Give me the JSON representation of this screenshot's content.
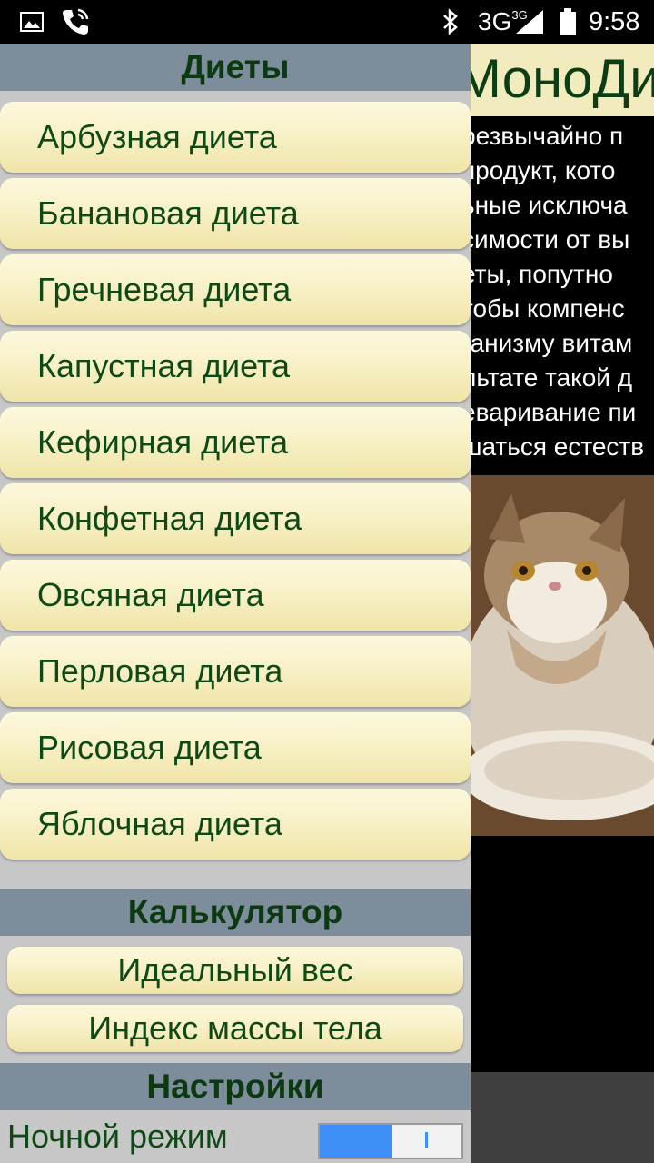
{
  "status_bar": {
    "network": "3G",
    "network_sup": "3G",
    "time": "9:58",
    "icons": [
      "gallery-icon",
      "wifi-call-icon",
      "bluetooth-icon",
      "signal-icon",
      "battery-icon"
    ]
  },
  "main": {
    "title": "МоноДи",
    "text_lines": [
      "резвычайно п",
      "продукт, кото",
      "ьные исключа",
      "симости от вы",
      "еты, попутно",
      "тобы компенс",
      "ганизму витам",
      "льтате такой д",
      "еваривание пи",
      "шаться естеств"
    ]
  },
  "drawer": {
    "diets_header": "Диеты",
    "diets": [
      "Арбузная диета",
      "Банановая диета",
      "Гречневая диета",
      "Капустная диета",
      "Кефирная диета",
      "Конфетная диета",
      "Овсяная диета",
      "Перловая диета",
      "Рисовая диета",
      "Яблочная диета"
    ],
    "calc_header": "Калькулятор",
    "calc_items": [
      "Идеальный вес",
      "Индекс массы тела"
    ],
    "settings_header": "Настройки",
    "night_mode_label": "Ночной режим",
    "night_mode_on": true
  },
  "colors": {
    "header_bg": "#7d8d9b",
    "header_text": "#0b3a11",
    "item_bg": "#f8f1c8",
    "item_text": "#0f4a16",
    "toggle_accent": "#3d8ff5",
    "drawer_bg": "#c7c7c7"
  }
}
